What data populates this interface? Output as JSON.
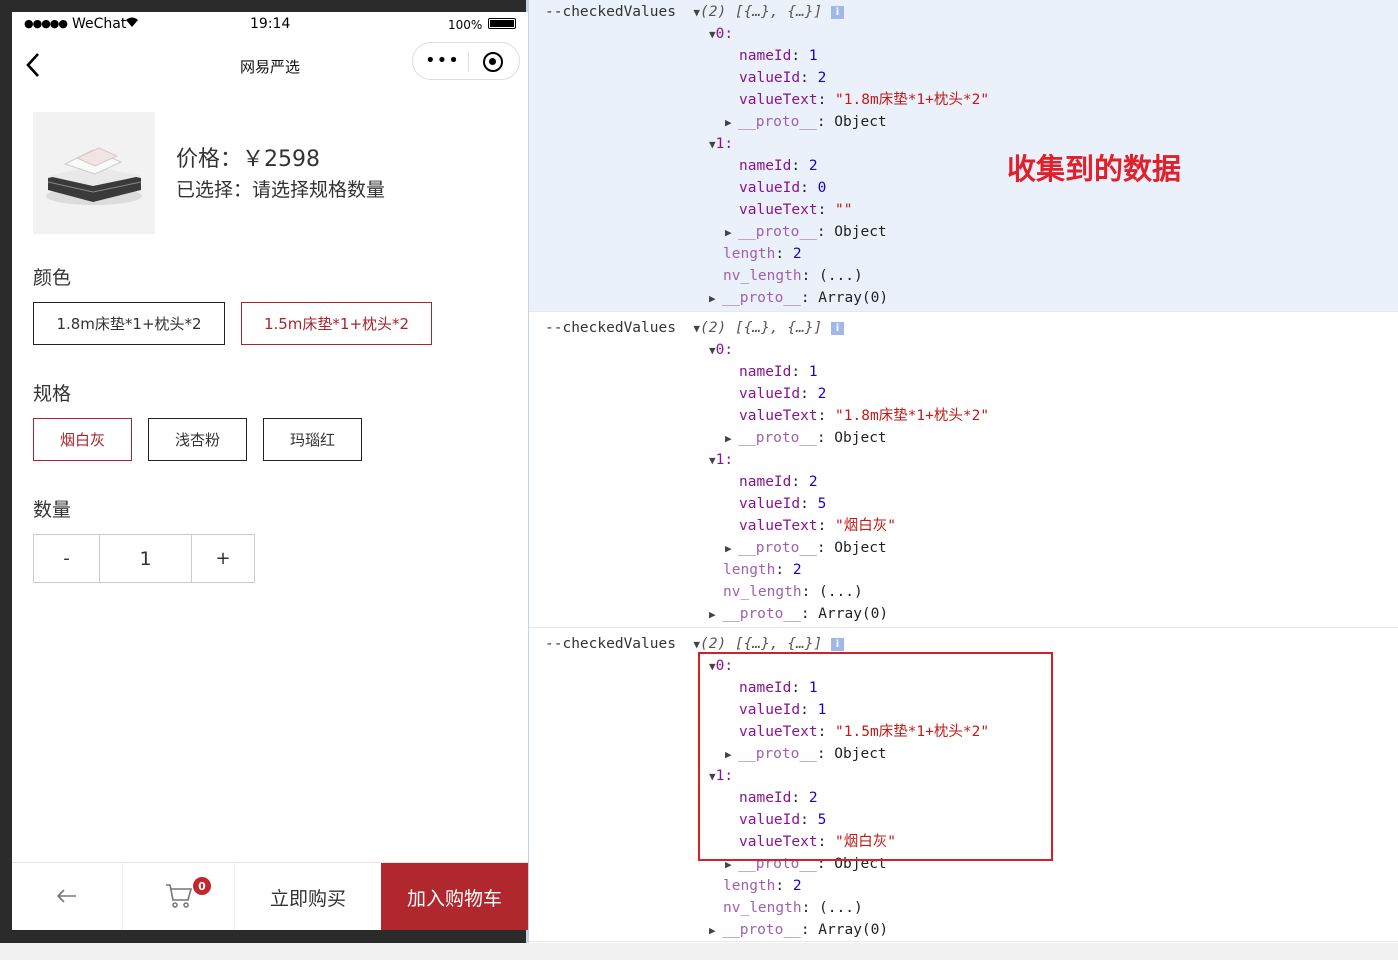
{
  "status_bar": {
    "signal": "●●●●●",
    "carrier": "WeChat",
    "time": "19:14",
    "battery": "100%"
  },
  "nav": {
    "title": "网易严选",
    "more": "•••"
  },
  "product": {
    "price": "价格：￥2598",
    "selected": "已选择：请选择规格数量",
    "sections": {
      "color": "颜色",
      "spec": "规格",
      "quantity": "数量"
    },
    "color_options": [
      {
        "label": "1.8m床垫*1+枕头*2",
        "active": false
      },
      {
        "label": "1.5m床垫*1+枕头*2",
        "active": true
      }
    ],
    "spec_options": [
      {
        "label": "烟白灰",
        "active": true
      },
      {
        "label": "浅杏粉",
        "active": false
      },
      {
        "label": "玛瑙红",
        "active": false
      }
    ],
    "stepper": {
      "minus": "-",
      "value": "1",
      "plus": "+"
    }
  },
  "bottom_bar": {
    "back": "←",
    "cart_count": "0",
    "buy_now": "立即购买",
    "add_to_cart": "加入购物车"
  },
  "console": {
    "log_label": "--checkedValues",
    "summary": "(2) [{…}, {…}]",
    "annotation": "收集到的数据",
    "keys": {
      "idx0": "0:",
      "idx1": "1:",
      "nameId": "nameId",
      "valueId": "valueId",
      "valueText": "valueText",
      "proto": "__proto__",
      "length": "length",
      "nv_length": "nv_length",
      "object": "Object",
      "array": "Array(0)",
      "getter": "(...)"
    },
    "blocks": [
      {
        "items": [
          {
            "nameId": "1",
            "valueId": "2",
            "valueText": "\"1.8m床垫*1+枕头*2\""
          },
          {
            "nameId": "2",
            "valueId": "0",
            "valueText": "\"\""
          }
        ],
        "length": "2"
      },
      {
        "items": [
          {
            "nameId": "1",
            "valueId": "2",
            "valueText": "\"1.8m床垫*1+枕头*2\""
          },
          {
            "nameId": "2",
            "valueId": "5",
            "valueText": "\"烟白灰\""
          }
        ],
        "length": "2"
      },
      {
        "items": [
          {
            "nameId": "1",
            "valueId": "1",
            "valueText": "\"1.5m床垫*1+枕头*2\""
          },
          {
            "nameId": "2",
            "valueId": "5",
            "valueText": "\"烟白灰\""
          }
        ],
        "length": "2"
      }
    ]
  },
  "colors": {
    "accent": "#b0282e",
    "annotation": "#e0202a",
    "console_highlight": "#eaf1fb"
  }
}
